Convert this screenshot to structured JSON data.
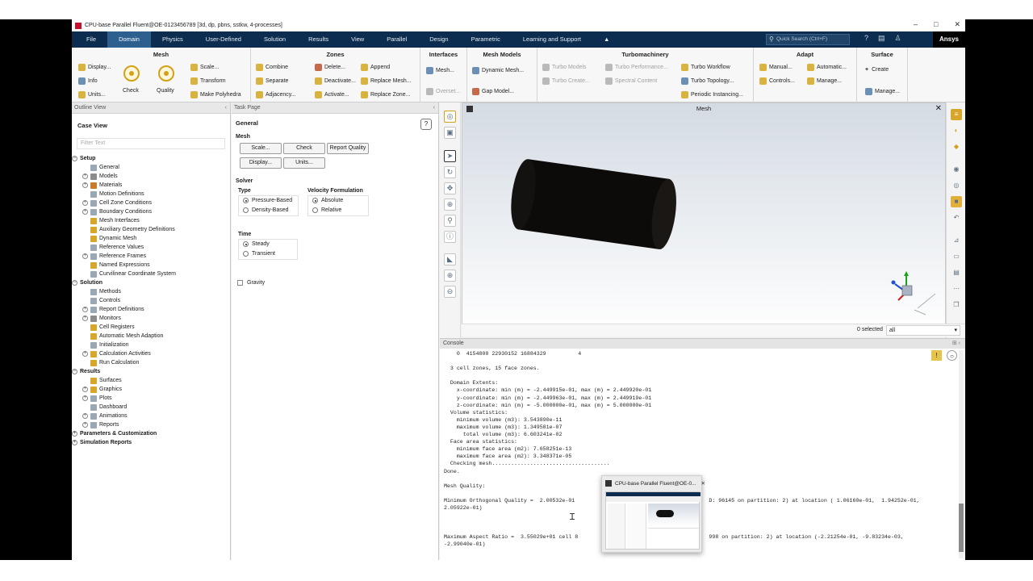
{
  "window": {
    "title": "CPU-base Parallel Fluent@OE-0123456789  [3d, dp, pbns, sstkw, 4-processes]",
    "min": "–",
    "max": "□",
    "close": "✕"
  },
  "menu": {
    "items": [
      "File",
      "Domain",
      "Physics",
      "User-Defined",
      "Solution",
      "Results",
      "View",
      "Parallel",
      "Design",
      "Parametric",
      "Learning and Support",
      "▲"
    ],
    "active": "Domain",
    "search_placeholder": "Quick Search (Ctrl+F)",
    "brand": "Ansys"
  },
  "ribbon": {
    "mesh": {
      "title": "Mesh",
      "display": "Display...",
      "info": "Info",
      "units": "Units...",
      "check": "Check",
      "quality": "Quality",
      "scale": "Scale...",
      "transform": "Transform",
      "polyhedra": "Make Polyhedra"
    },
    "zones": {
      "title": "Zones",
      "combine": "Combine",
      "separate": "Separate",
      "adjacency": "Adjacency...",
      "delete": "Delete...",
      "deactivate": "Deactivate...",
      "activate": "Activate...",
      "append": "Append",
      "replace_mesh": "Replace Mesh...",
      "replace_zone": "Replace Zone..."
    },
    "interfaces": {
      "title": "Interfaces",
      "mesh": "Mesh...",
      "overset": "Overset..."
    },
    "mesh_models": {
      "title": "Mesh Models",
      "dynamic": "Dynamic Mesh...",
      "gap": "Gap Model..."
    },
    "turbo": {
      "title": "Turbomachinery",
      "models": "Turbo Models",
      "create": "Turbo Create...",
      "performance": "Turbo Performance...",
      "spectral": "Spectral Content",
      "workflow": "Turbo Workflow",
      "topology": "Turbo Topology...",
      "periodic": "Periodic Instancing..."
    },
    "adapt": {
      "title": "Adapt",
      "manual": "Manual...",
      "automatic": "Automatic...",
      "controls": "Controls...",
      "manage": "Manage..."
    },
    "surface": {
      "title": "Surface",
      "create": "Create",
      "manage": "Manage..."
    }
  },
  "outline": {
    "header": "Outline View",
    "case_view": "Case View",
    "filter_placeholder": "Filter Text",
    "setup": "Setup",
    "setup_items": [
      "General",
      "Models",
      "Materials",
      "Motion Definitions",
      "Cell Zone Conditions",
      "Boundary Conditions",
      "Mesh Interfaces",
      "Auxiliary Geometry Definitions",
      "Dynamic Mesh",
      "Reference Values",
      "Reference Frames",
      "Named Expressions",
      "Curvilinear Coordinate System"
    ],
    "solution": "Solution",
    "solution_items": [
      "Methods",
      "Controls",
      "Report Definitions",
      "Monitors",
      "Cell Registers",
      "Automatic Mesh Adaption",
      "Initialization",
      "Calculation Activities",
      "Run Calculation"
    ],
    "results": "Results",
    "results_items": [
      "Surfaces",
      "Graphics",
      "Plots",
      "Dashboard",
      "Animations",
      "Reports"
    ],
    "params": "Parameters & Customization",
    "reports": "Simulation Reports"
  },
  "task": {
    "header": "Task Page",
    "general": "General",
    "mesh": "Mesh",
    "scale": "Scale...",
    "check": "Check",
    "report_quality": "Report Quality",
    "display": "Display...",
    "units": "Units...",
    "solver": "Solver",
    "type": "Type",
    "pressure": "Pressure-Based",
    "density": "Density-Based",
    "velocity": "Velocity Formulation",
    "absolute": "Absolute",
    "relative": "Relative",
    "time": "Time",
    "steady": "Steady",
    "transient": "Transient",
    "gravity": "Gravity",
    "help": "?"
  },
  "graphics": {
    "title": "Mesh",
    "close": "✕",
    "selected_label": "0 selected",
    "selected_value": "all"
  },
  "console": {
    "header": "Console",
    "lines": [
      "    0  4154800 22930152 16884329          4",
      "",
      "  3 cell zones, 15 face zones.",
      "",
      "  Domain Extents:",
      "    x-coordinate: min (m) = -2.449915e-01, max (m) = 2.449920e-01",
      "    y-coordinate: min (m) = -2.449963e-01, max (m) = 2.449919e-01",
      "    z-coordinate: min (m) = -5.000000e-01, max (m) = 5.000000e-01",
      "  Volume statistics:",
      "    minimum volume (m3): 3.543890e-11",
      "    maximum volume (m3): 1.349581e-07",
      "      total volume (m3): 6.603241e-02",
      "  Face area statistics:",
      "    minimum face area (m2): 7.658251e-13",
      "    maximum face area (m2): 3.348371e-05",
      "  Checking mesh.....................................",
      "Done.",
      "",
      "Mesh Quality:",
      "",
      "Minimum Orthogonal Quality =  2.00532e-01                                          D: 96145 on partition: 2) at location ( 1.06160e-01,  1.94252e-01,",
      "2.05922e-01)",
      "",
      "",
      "",
      "Maximum Aspect Ratio =  3.55029e+01 cell 8                                         998 on partition: 2) at location (-2.21254e-01, -9.83234e-03,",
      "-2.99040e-01)"
    ]
  },
  "popup": {
    "title": "CPU-base Parallel Fluent@OE-0...",
    "close": "✕"
  }
}
